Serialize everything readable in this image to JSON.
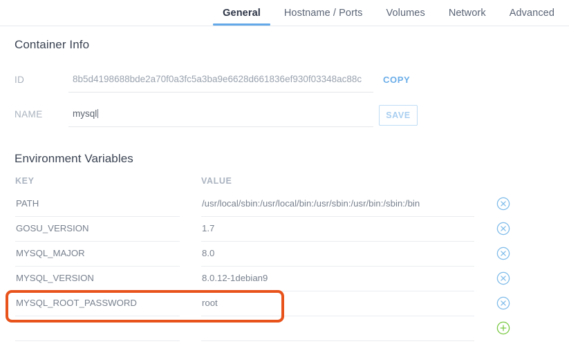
{
  "tabs": [
    {
      "label": "General",
      "active": true
    },
    {
      "label": "Hostname / Ports",
      "active": false
    },
    {
      "label": "Volumes",
      "active": false
    },
    {
      "label": "Network",
      "active": false
    },
    {
      "label": "Advanced",
      "active": false
    }
  ],
  "container_info": {
    "title": "Container Info",
    "id_label": "ID",
    "id_value": "8b5d4198688bde2a70f0a3fc5a3ba9e6628d661836ef930f03348ac88c",
    "copy_label": "COPY",
    "name_label": "NAME",
    "name_value": "mysql",
    "save_label": "SAVE"
  },
  "environment_variables": {
    "title": "Environment Variables",
    "columns": [
      "KEY",
      "VALUE"
    ],
    "rows": [
      {
        "key": "PATH",
        "value": "/usr/local/sbin:/usr/local/bin:/usr/sbin:/usr/bin:/sbin:/bin",
        "action": "remove-icon",
        "highlighted": false
      },
      {
        "key": "GOSU_VERSION",
        "value": "1.7",
        "action": "remove-icon",
        "highlighted": false
      },
      {
        "key": "MYSQL_MAJOR",
        "value": "8.0",
        "action": "remove-icon",
        "highlighted": false
      },
      {
        "key": "MYSQL_VERSION",
        "value": "8.0.12-1debian9",
        "action": "remove-icon",
        "highlighted": false
      },
      {
        "key": "MYSQL_ROOT_PASSWORD",
        "value": "root",
        "action": "remove-icon",
        "highlighted": true
      },
      {
        "key": "",
        "value": "",
        "action": "add-icon",
        "highlighted": false
      }
    ]
  },
  "colors": {
    "accent_blue": "#63a8e8",
    "link_blue": "#6aade8",
    "remove_icon": "#7fbcea",
    "add_icon": "#7ac943",
    "highlight_orange": "#e8531c",
    "label_gray": "#a9b2bd",
    "text_gray": "#78818e"
  }
}
